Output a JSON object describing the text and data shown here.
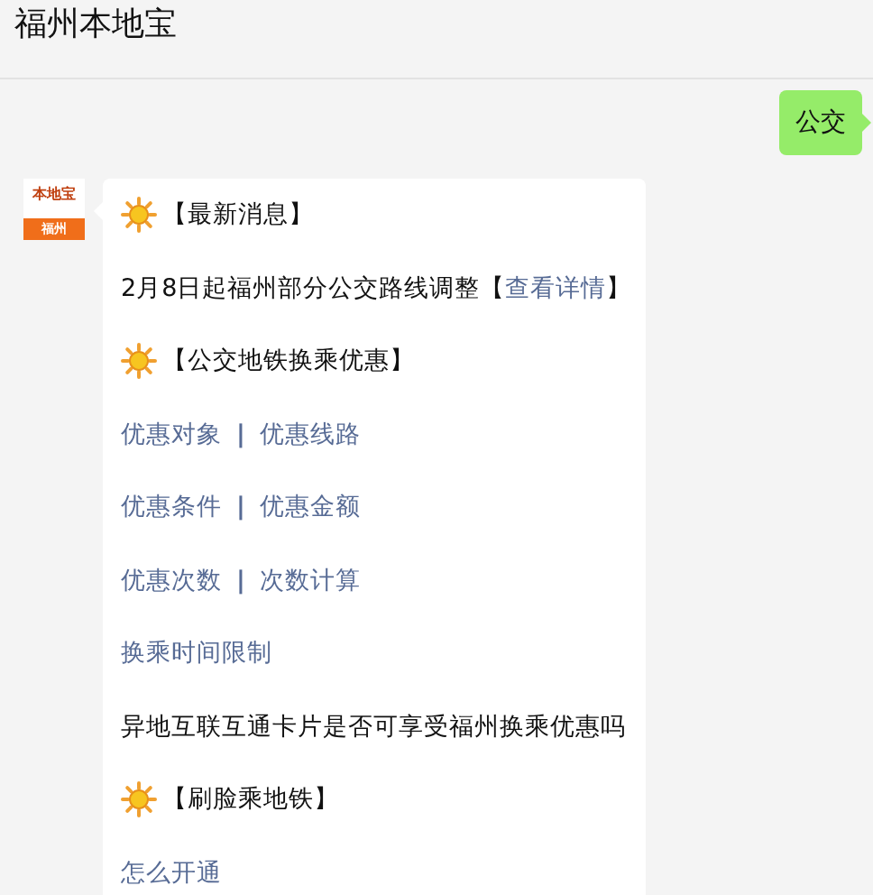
{
  "header": {
    "title": "福州本地宝"
  },
  "sent_message": {
    "text": "公交"
  },
  "avatar": {
    "brand": "本地宝",
    "city": "福州"
  },
  "reply_lines": [
    {
      "kind": "heading",
      "text": "【最新消息】"
    },
    {
      "kind": "text",
      "text": "2月8日起福州部分公交路线调整【",
      "link": "查看详情",
      "after": "】"
    },
    {
      "kind": "heading",
      "text": "【公交地铁换乘优惠】"
    },
    {
      "kind": "links",
      "links": [
        "优惠对象",
        "优惠线路"
      ],
      "separator": "|"
    },
    {
      "kind": "links",
      "links": [
        "优惠条件",
        "优惠金额"
      ],
      "separator": "|"
    },
    {
      "kind": "links",
      "links": [
        "优惠次数",
        "次数计算"
      ],
      "separator": "|"
    },
    {
      "kind": "links",
      "links": [
        "换乘时间限制"
      ]
    },
    {
      "kind": "text",
      "text": "异地互联互通卡片是否可享受福州换乘优惠吗"
    },
    {
      "kind": "heading",
      "text": "【刷脸乘地铁】"
    },
    {
      "kind": "links",
      "links": [
        "怎么开通"
      ]
    }
  ]
}
